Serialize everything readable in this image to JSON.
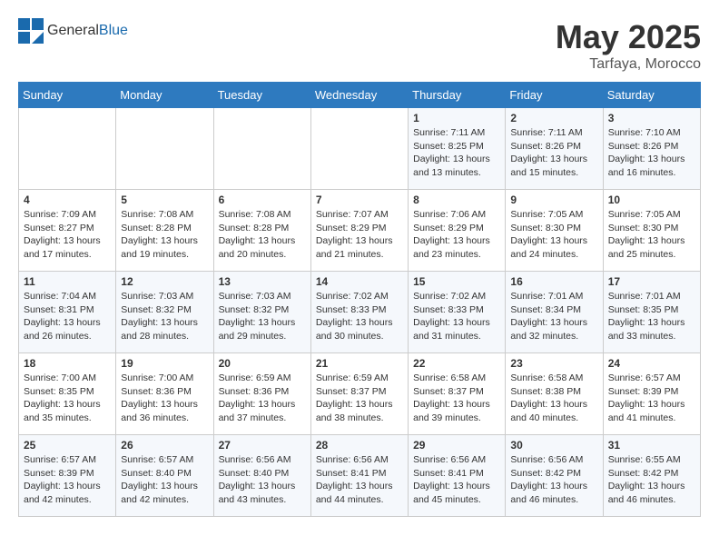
{
  "header": {
    "logo_general": "General",
    "logo_blue": "Blue",
    "title": "May 2025",
    "location": "Tarfaya, Morocco"
  },
  "days_of_week": [
    "Sunday",
    "Monday",
    "Tuesday",
    "Wednesday",
    "Thursday",
    "Friday",
    "Saturday"
  ],
  "weeks": [
    [
      {
        "day": "",
        "content": ""
      },
      {
        "day": "",
        "content": ""
      },
      {
        "day": "",
        "content": ""
      },
      {
        "day": "",
        "content": ""
      },
      {
        "day": "1",
        "content": "Sunrise: 7:11 AM\nSunset: 8:25 PM\nDaylight: 13 hours\nand 13 minutes."
      },
      {
        "day": "2",
        "content": "Sunrise: 7:11 AM\nSunset: 8:26 PM\nDaylight: 13 hours\nand 15 minutes."
      },
      {
        "day": "3",
        "content": "Sunrise: 7:10 AM\nSunset: 8:26 PM\nDaylight: 13 hours\nand 16 minutes."
      }
    ],
    [
      {
        "day": "4",
        "content": "Sunrise: 7:09 AM\nSunset: 8:27 PM\nDaylight: 13 hours\nand 17 minutes."
      },
      {
        "day": "5",
        "content": "Sunrise: 7:08 AM\nSunset: 8:28 PM\nDaylight: 13 hours\nand 19 minutes."
      },
      {
        "day": "6",
        "content": "Sunrise: 7:08 AM\nSunset: 8:28 PM\nDaylight: 13 hours\nand 20 minutes."
      },
      {
        "day": "7",
        "content": "Sunrise: 7:07 AM\nSunset: 8:29 PM\nDaylight: 13 hours\nand 21 minutes."
      },
      {
        "day": "8",
        "content": "Sunrise: 7:06 AM\nSunset: 8:29 PM\nDaylight: 13 hours\nand 23 minutes."
      },
      {
        "day": "9",
        "content": "Sunrise: 7:05 AM\nSunset: 8:30 PM\nDaylight: 13 hours\nand 24 minutes."
      },
      {
        "day": "10",
        "content": "Sunrise: 7:05 AM\nSunset: 8:30 PM\nDaylight: 13 hours\nand 25 minutes."
      }
    ],
    [
      {
        "day": "11",
        "content": "Sunrise: 7:04 AM\nSunset: 8:31 PM\nDaylight: 13 hours\nand 26 minutes."
      },
      {
        "day": "12",
        "content": "Sunrise: 7:03 AM\nSunset: 8:32 PM\nDaylight: 13 hours\nand 28 minutes."
      },
      {
        "day": "13",
        "content": "Sunrise: 7:03 AM\nSunset: 8:32 PM\nDaylight: 13 hours\nand 29 minutes."
      },
      {
        "day": "14",
        "content": "Sunrise: 7:02 AM\nSunset: 8:33 PM\nDaylight: 13 hours\nand 30 minutes."
      },
      {
        "day": "15",
        "content": "Sunrise: 7:02 AM\nSunset: 8:33 PM\nDaylight: 13 hours\nand 31 minutes."
      },
      {
        "day": "16",
        "content": "Sunrise: 7:01 AM\nSunset: 8:34 PM\nDaylight: 13 hours\nand 32 minutes."
      },
      {
        "day": "17",
        "content": "Sunrise: 7:01 AM\nSunset: 8:35 PM\nDaylight: 13 hours\nand 33 minutes."
      }
    ],
    [
      {
        "day": "18",
        "content": "Sunrise: 7:00 AM\nSunset: 8:35 PM\nDaylight: 13 hours\nand 35 minutes."
      },
      {
        "day": "19",
        "content": "Sunrise: 7:00 AM\nSunset: 8:36 PM\nDaylight: 13 hours\nand 36 minutes."
      },
      {
        "day": "20",
        "content": "Sunrise: 6:59 AM\nSunset: 8:36 PM\nDaylight: 13 hours\nand 37 minutes."
      },
      {
        "day": "21",
        "content": "Sunrise: 6:59 AM\nSunset: 8:37 PM\nDaylight: 13 hours\nand 38 minutes."
      },
      {
        "day": "22",
        "content": "Sunrise: 6:58 AM\nSunset: 8:37 PM\nDaylight: 13 hours\nand 39 minutes."
      },
      {
        "day": "23",
        "content": "Sunrise: 6:58 AM\nSunset: 8:38 PM\nDaylight: 13 hours\nand 40 minutes."
      },
      {
        "day": "24",
        "content": "Sunrise: 6:57 AM\nSunset: 8:39 PM\nDaylight: 13 hours\nand 41 minutes."
      }
    ],
    [
      {
        "day": "25",
        "content": "Sunrise: 6:57 AM\nSunset: 8:39 PM\nDaylight: 13 hours\nand 42 minutes."
      },
      {
        "day": "26",
        "content": "Sunrise: 6:57 AM\nSunset: 8:40 PM\nDaylight: 13 hours\nand 42 minutes."
      },
      {
        "day": "27",
        "content": "Sunrise: 6:56 AM\nSunset: 8:40 PM\nDaylight: 13 hours\nand 43 minutes."
      },
      {
        "day": "28",
        "content": "Sunrise: 6:56 AM\nSunset: 8:41 PM\nDaylight: 13 hours\nand 44 minutes."
      },
      {
        "day": "29",
        "content": "Sunrise: 6:56 AM\nSunset: 8:41 PM\nDaylight: 13 hours\nand 45 minutes."
      },
      {
        "day": "30",
        "content": "Sunrise: 6:56 AM\nSunset: 8:42 PM\nDaylight: 13 hours\nand 46 minutes."
      },
      {
        "day": "31",
        "content": "Sunrise: 6:55 AM\nSunset: 8:42 PM\nDaylight: 13 hours\nand 46 minutes."
      }
    ]
  ]
}
